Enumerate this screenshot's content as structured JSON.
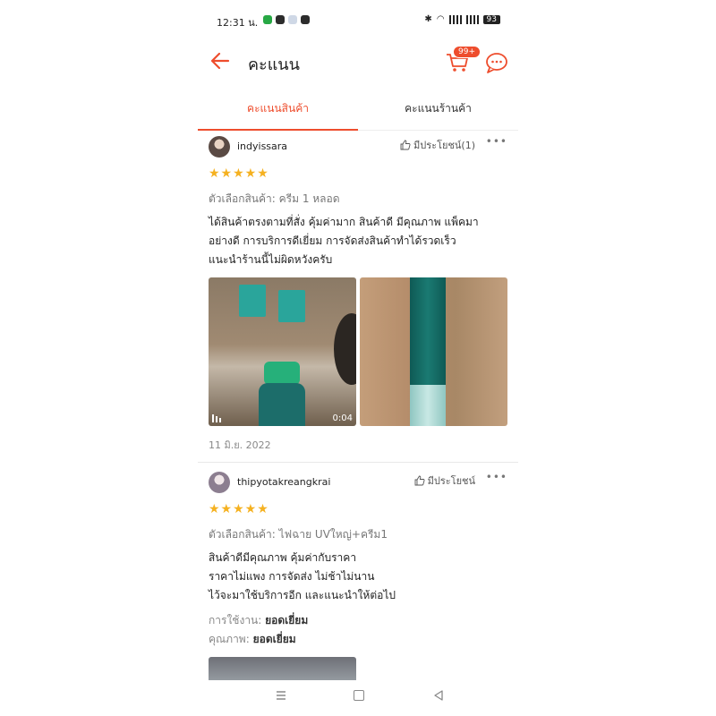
{
  "status_bar": {
    "time": "12:31 น.",
    "battery": "93"
  },
  "header": {
    "title": "คะแนน",
    "cart_badge": "99+"
  },
  "tabs": [
    {
      "label": "คะแนนสินค้า",
      "active": true
    },
    {
      "label": "คะแนนร้านค้า",
      "active": false
    }
  ],
  "reviews": [
    {
      "username": "indyissara",
      "helpful": "มีประโยชน์(1)",
      "stars": "★★★★★",
      "rating": 5,
      "variation_label": "ตัวเลือกสินค้า:",
      "variation_value": "ครีม 1 หลอด",
      "comment_lines": [
        "ได้สินค้าตรงตามที่สั่ง คุ้มค่ามาก สินค้าดี มีคุณภาพ แพ็คมา",
        "อย่างดี การบริการดีเยี่ยม การจัดส่งสินค้าทำได้รวดเร็ว",
        "แนะนำร้านนี้ไม่ผิดหวังครับ"
      ],
      "video_duration": "0:04",
      "date": "11 มิ.ย. 2022"
    },
    {
      "username": "thipyotakreangkrai",
      "helpful": "มีประโยชน์",
      "stars": "★★★★★",
      "rating": 5,
      "variation_label": "ตัวเลือกสินค้า:",
      "variation_value": "ไฟฉาย UVใหญ่+ครีม1",
      "comment_lines": [
        "สินค้าดีมีคุณภาพ คุ้มค่ากับราคา",
        "ราคาไม่แพง  การจัดส่ง ไม่ช้าไม่นาน",
        "ไว้จะมาใช้บริการอีก และแนะนำให้ต่อไป"
      ],
      "usage_label": "การใช้งาน:",
      "usage_value": "ยอดเยี่ยม",
      "quality_label": "คุณภาพ:",
      "quality_value": "ยอดเยี่ยม"
    }
  ],
  "colors": {
    "accent": "#ee4d2d",
    "star": "#f5b120"
  }
}
